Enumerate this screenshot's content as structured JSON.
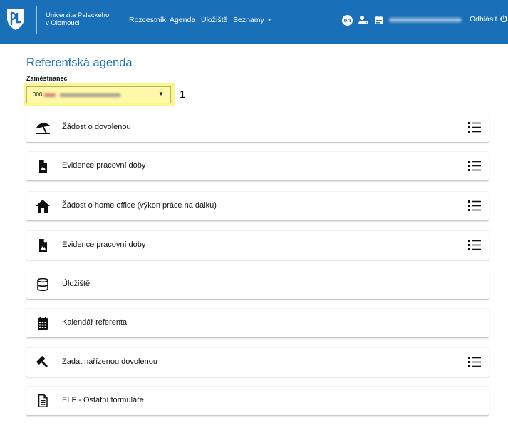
{
  "header": {
    "university_line1": "Univerzita Palackého",
    "university_line2": "v Olomouci",
    "nav": [
      {
        "label": "Rozcestník"
      },
      {
        "label": "Agenda"
      },
      {
        "label": "Úložiště"
      },
      {
        "label": "Seznamy"
      }
    ],
    "lang": "en",
    "logout": "Odhlásit",
    "icons": [
      "university-logo",
      "user-gear-icon",
      "calendar-icon",
      "power-icon"
    ]
  },
  "page": {
    "title": "Referentská agenda",
    "employee_label": "Zaměstnanec",
    "employee_prefix": "000",
    "annotation": "1"
  },
  "cards": [
    {
      "label": "Žádost o dovolenou",
      "icon": "beach-umbrella-icon",
      "has_list": true
    },
    {
      "label": "Evidence pracovní doby",
      "icon": "document-icon",
      "has_list": true
    },
    {
      "label": "Žádost o home office (výkon práce na dálku)",
      "icon": "home-icon",
      "has_list": true
    },
    {
      "label": "Evidence pracovní doby",
      "icon": "document-icon",
      "has_list": true
    },
    {
      "label": "Úložiště",
      "icon": "database-icon",
      "has_list": false
    },
    {
      "label": "Kalendář referenta",
      "icon": "calendar-icon",
      "has_list": false
    },
    {
      "label": "Zadat nařízenou dovolenou",
      "icon": "gavel-icon",
      "has_list": true
    },
    {
      "label": "ELF - Ostatní formuláře",
      "icon": "file-text-icon",
      "has_list": false
    }
  ],
  "colors": {
    "brand": "#1a70b8",
    "highlight": "#faf78f"
  }
}
